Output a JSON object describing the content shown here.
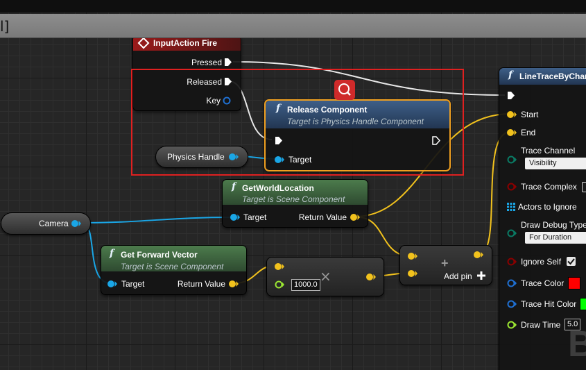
{
  "editor": {
    "tab_glyph": "l]",
    "watermark": "B"
  },
  "nodes": {
    "input_action": {
      "title": "InputAction Fire",
      "pins": {
        "pressed": "Pressed",
        "released": "Released",
        "key": "Key"
      }
    },
    "release_component": {
      "title": "Release Component",
      "subtitle": "Target is Physics Handle Component",
      "pins": {
        "target": "Target"
      }
    },
    "physics_handle_var": {
      "label": "Physics Handle"
    },
    "camera_var": {
      "label": "Camera"
    },
    "get_world_location": {
      "title": "GetWorldLocation",
      "subtitle": "Target is Scene Component",
      "pins": {
        "target": "Target",
        "return_value": "Return Value"
      }
    },
    "get_forward_vector": {
      "title": "Get Forward Vector",
      "subtitle": "Target is Scene Component",
      "pins": {
        "target": "Target",
        "return_value": "Return Value"
      }
    },
    "multiply": {
      "symbol": "×",
      "value": "1000.0"
    },
    "add": {
      "symbol": "+",
      "add_pin_label": "Add pin"
    },
    "line_trace": {
      "title": "LineTraceByChan",
      "pins": {
        "start": "Start",
        "end": "End",
        "trace_channel": "Trace Channel",
        "trace_channel_value": "Visibility",
        "trace_complex": "Trace Complex",
        "actors_to_ignore": "Actors to Ignore",
        "draw_debug_type": "Draw Debug Type",
        "draw_debug_type_value": "For Duration",
        "ignore_self": "Ignore Self",
        "trace_color": "Trace Color",
        "trace_hit_color": "Trace Hit Color",
        "draw_time": "Draw Time",
        "draw_time_value": "5.0"
      }
    }
  },
  "colors": {
    "exec": "#ffffff",
    "object_pin": "#1aa6e6",
    "vector_pin": "#f2c21d",
    "float_pin": "#9be632",
    "byte_pin": "#0a7a64",
    "bool_pin": "#8a0000",
    "struct_pin": "#1f6fd1",
    "event_head": "#8e1414",
    "function_head": "#2c4a73",
    "pure_head": "#3f6b42",
    "selection": "#e02020",
    "trace_color": "#ff0000",
    "trace_hit_color": "#00ff00"
  },
  "icons": {
    "search": "search-icon",
    "event": "event-diamond-icon",
    "function": "function-icon",
    "multiply": "multiply-icon",
    "add": "add-icon",
    "check": "check-icon"
  }
}
